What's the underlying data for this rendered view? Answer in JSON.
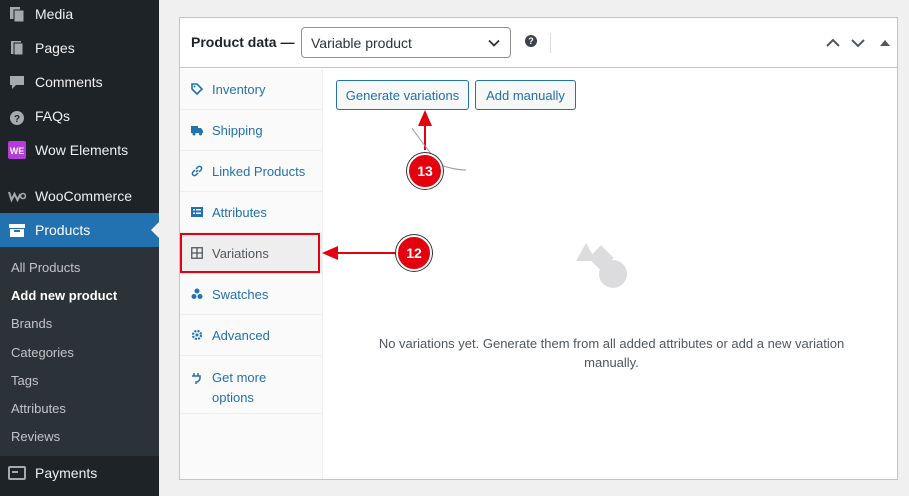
{
  "sidebar": {
    "menu": [
      {
        "label": "Media",
        "icon": "media-icon"
      },
      {
        "label": "Pages",
        "icon": "pages-icon"
      },
      {
        "label": "Comments",
        "icon": "comments-icon"
      },
      {
        "label": "FAQs",
        "icon": "help-circle-icon"
      },
      {
        "label": "Wow Elements",
        "icon": "wow-elements-icon"
      },
      {
        "label": "WooCommerce",
        "icon": "woocommerce-icon"
      },
      {
        "label": "Products",
        "icon": "archive-box-icon"
      }
    ],
    "submenu": [
      "All Products",
      "Add new product",
      "Brands",
      "Categories",
      "Tags",
      "Attributes",
      "Reviews"
    ],
    "bottom": {
      "label": "Payments",
      "icon": "payments-icon"
    }
  },
  "product_data": {
    "title": "Product data —",
    "type_select": "Variable product",
    "help_icon": "?",
    "tabs": [
      {
        "label": "Inventory",
        "icon": "tag-icon"
      },
      {
        "label": "Shipping",
        "icon": "truck-icon"
      },
      {
        "label": "Linked Products",
        "icon": "link-icon"
      },
      {
        "label": "Attributes",
        "icon": "list-icon"
      },
      {
        "label": "Variations",
        "icon": "grid-icon"
      },
      {
        "label": "Swatches",
        "icon": "swatches-icon"
      },
      {
        "label": "Advanced",
        "icon": "gear-icon"
      },
      {
        "label": "Get more options",
        "icon": "plugin-icon"
      }
    ],
    "buttons": {
      "generate": "Generate variations",
      "add_manually": "Add manually"
    },
    "empty_message": "No variations yet. Generate them from all added attributes or add a new variation manually."
  },
  "annotations": {
    "step_12": "12",
    "step_13": "13",
    "color": "#e3000f"
  }
}
